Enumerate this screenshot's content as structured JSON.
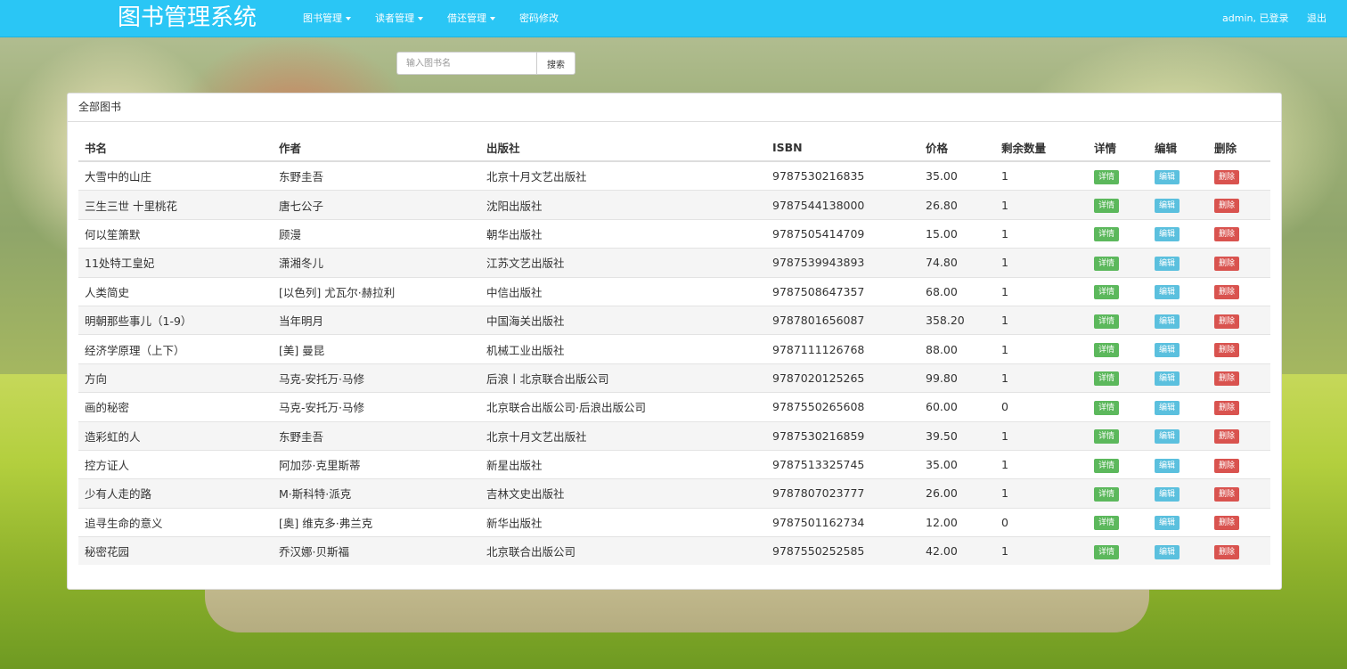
{
  "navbar": {
    "brand": "图书管理系统",
    "menu": [
      {
        "label": "图书管理"
      },
      {
        "label": "读者管理"
      },
      {
        "label": "借还管理"
      },
      {
        "label": "密码修改"
      }
    ],
    "user_status": "admin, 已登录",
    "logout": "退出"
  },
  "search": {
    "placeholder": "输入图书名",
    "button": "搜索"
  },
  "panel": {
    "title": "全部图书"
  },
  "table": {
    "headers": [
      "书名",
      "作者",
      "出版社",
      "ISBN",
      "价格",
      "剩余数量",
      "详情",
      "编辑",
      "删除"
    ],
    "action_labels": {
      "detail": "详情",
      "edit": "编辑",
      "delete": "删除"
    },
    "rows": [
      {
        "title": "大雪中的山庄",
        "author": "东野圭吾",
        "publisher": "北京十月文艺出版社",
        "isbn": "9787530216835",
        "price": "35.00",
        "stock": "1"
      },
      {
        "title": "三生三世 十里桃花",
        "author": "唐七公子",
        "publisher": "沈阳出版社",
        "isbn": "9787544138000",
        "price": "26.80",
        "stock": "1"
      },
      {
        "title": "何以笙箫默",
        "author": "顾漫",
        "publisher": "朝华出版社",
        "isbn": "9787505414709",
        "price": "15.00",
        "stock": "1"
      },
      {
        "title": "11处特工皇妃",
        "author": "潇湘冬儿",
        "publisher": "江苏文艺出版社",
        "isbn": "9787539943893",
        "price": "74.80",
        "stock": "1"
      },
      {
        "title": "人类简史",
        "author": "[以色列] 尤瓦尔·赫拉利",
        "publisher": "中信出版社",
        "isbn": "9787508647357",
        "price": "68.00",
        "stock": "1"
      },
      {
        "title": "明朝那些事儿（1-9）",
        "author": "当年明月",
        "publisher": "中国海关出版社",
        "isbn": "9787801656087",
        "price": "358.20",
        "stock": "1"
      },
      {
        "title": "经济学原理（上下）",
        "author": "[美] 曼昆",
        "publisher": "机械工业出版社",
        "isbn": "9787111126768",
        "price": "88.00",
        "stock": "1"
      },
      {
        "title": "方向",
        "author": "马克-安托万·马修",
        "publisher": "后浪丨北京联合出版公司",
        "isbn": "9787020125265",
        "price": "99.80",
        "stock": "1"
      },
      {
        "title": "画的秘密",
        "author": "马克-安托万·马修",
        "publisher": "北京联合出版公司·后浪出版公司",
        "isbn": "9787550265608",
        "price": "60.00",
        "stock": "0"
      },
      {
        "title": "造彩虹的人",
        "author": "东野圭吾",
        "publisher": "北京十月文艺出版社",
        "isbn": "9787530216859",
        "price": "39.50",
        "stock": "1"
      },
      {
        "title": "控方证人",
        "author": "阿加莎·克里斯蒂",
        "publisher": "新星出版社",
        "isbn": "9787513325745",
        "price": "35.00",
        "stock": "1"
      },
      {
        "title": "少有人走的路",
        "author": "M·斯科特·派克",
        "publisher": "吉林文史出版社",
        "isbn": "9787807023777",
        "price": "26.00",
        "stock": "1"
      },
      {
        "title": "追寻生命的意义",
        "author": "[奥] 维克多·弗兰克",
        "publisher": "新华出版社",
        "isbn": "9787501162734",
        "price": "12.00",
        "stock": "0"
      },
      {
        "title": "秘密花园",
        "author": "乔汉娜·贝斯福",
        "publisher": "北京联合出版公司",
        "isbn": "9787550252585",
        "price": "42.00",
        "stock": "1"
      }
    ]
  },
  "colors": {
    "navbar": "#2ac6f5",
    "detail_button": "#5cb85c",
    "edit_button": "#5bc0de",
    "delete_button": "#d9534f"
  }
}
